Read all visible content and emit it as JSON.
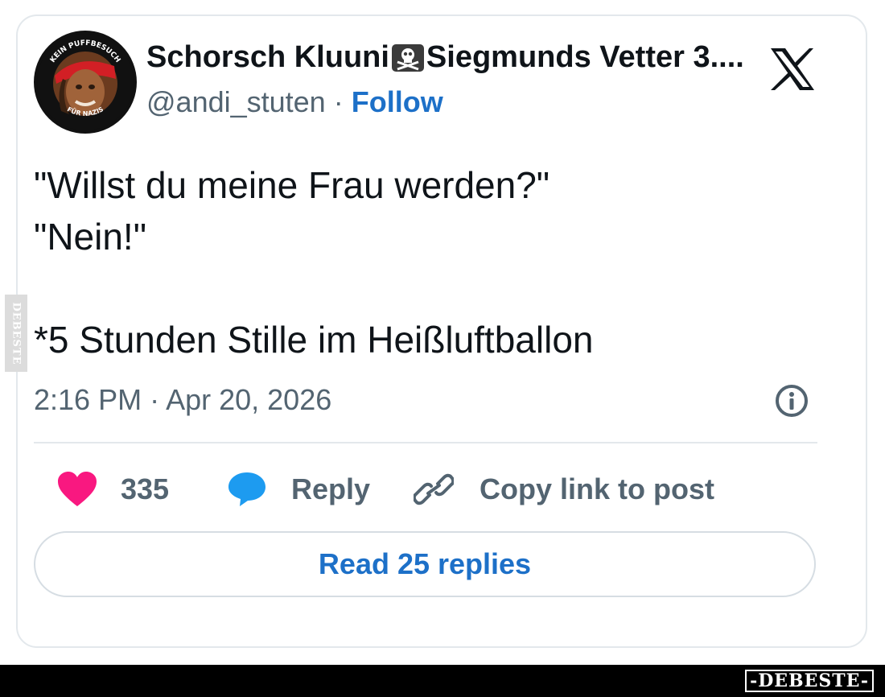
{
  "header": {
    "display_name_part1": "Schorsch Kluuni",
    "display_name_part2": "Siegmunds Vetter 3....",
    "handle": "@andi_stuten",
    "separator": "·",
    "follow_label": "Follow",
    "avatar_text_top": "KEIN PUFFBESUCH",
    "avatar_text_bottom": "FÜR NAZIS"
  },
  "tweet": {
    "text": "\"Willst du meine Frau werden?\"\n\"Nein!\"\n\n*5 Stunden Stille im Heißluftballon",
    "timestamp": "2:16 PM · Apr 20, 2026"
  },
  "actions": {
    "like_count": "335",
    "reply_label": "Reply",
    "copy_link_label": "Copy link to post"
  },
  "read_replies_label": "Read 25 replies",
  "watermark": {
    "side": "DEBESTE",
    "bottom": "-DEBESTE-"
  },
  "colors": {
    "link_blue": "#1d70c8",
    "heart_pink": "#f91880",
    "reply_blue": "#1d9bf0",
    "secondary_text": "#536471",
    "border": "#e3e8ec"
  },
  "icons": [
    "x-logo-icon",
    "pirate-flag-icon",
    "info-icon",
    "heart-icon",
    "reply-bubble-icon",
    "link-icon"
  ]
}
